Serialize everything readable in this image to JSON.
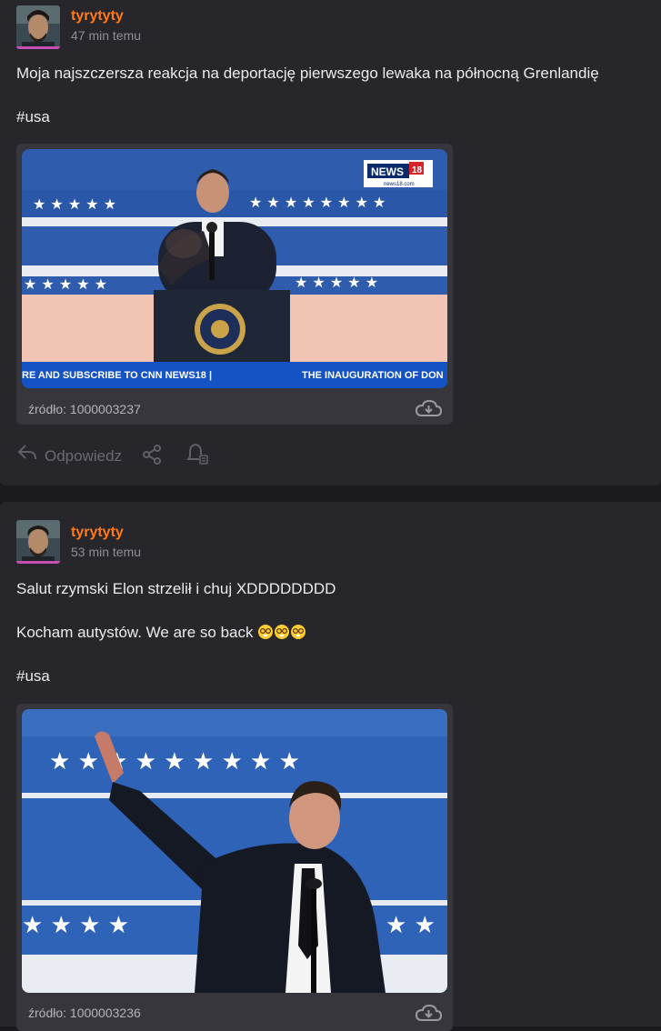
{
  "posts": [
    {
      "username": "tyrytyty",
      "time": "47 min temu",
      "text_line1": "Moja najszczersza reakcja na deportację pierwszego lewaka na północną Grenlandię",
      "tag": "#usa",
      "media": {
        "channel_logo": "NEWS",
        "channel_logo_number": "18",
        "channel_url": "news18.com",
        "ticker_left": "RE AND SUBSCRIBE TO CNN NEWS18 |",
        "ticker_right": "THE INAUGURATION OF DON"
      },
      "source": "źródło: 1000003237",
      "reply_label": "Odpowiedz"
    },
    {
      "username": "tyrytyty",
      "time": "53 min temu",
      "text_line1": "Salut rzymski Elon strzelił i chuj XDDDDDDDD",
      "text_line2": "Kocham autystów. We are so back",
      "tag": "#usa",
      "source": "źródło: 1000003236"
    }
  ],
  "icons": {
    "reply": "reply-arrow-icon",
    "share": "share-icon",
    "notify": "bell-icon",
    "download": "cloud-download-icon",
    "emoji": "nerd-face-emoji"
  },
  "colors": {
    "background": "#1b1b1f",
    "card": "#26262b",
    "username": "#ff7a1a",
    "avatar_accent": "#c64fb7"
  }
}
